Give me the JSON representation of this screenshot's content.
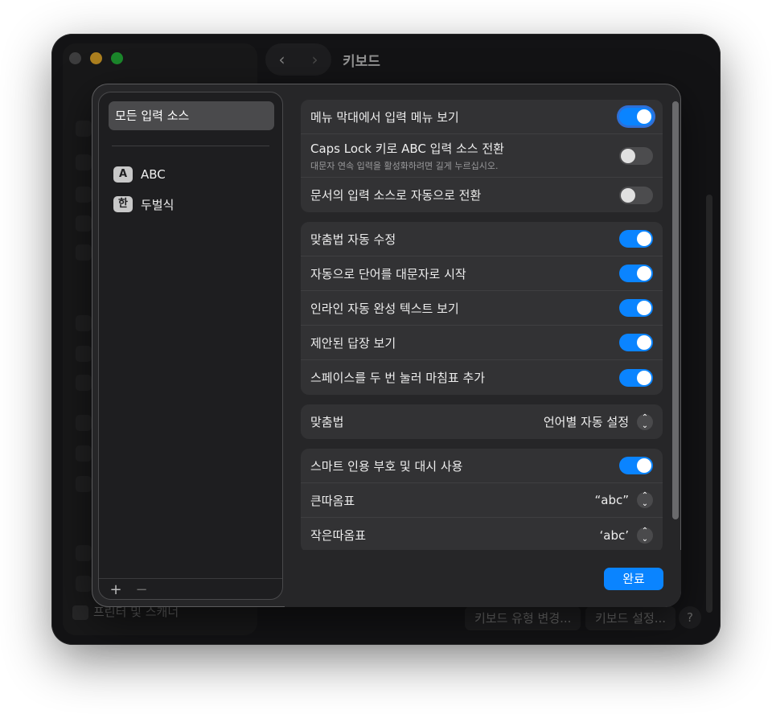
{
  "back_window": {
    "title": "키보드",
    "footer_sidebar_item": "프린터 및 스캐너",
    "footer_buttons": [
      "키보드 유형 변경...",
      "키보드 설정..."
    ],
    "help_label": "?"
  },
  "sheet": {
    "sidebar": {
      "selected_label": "모든 입력 소스",
      "sources": [
        {
          "badge": "A",
          "label": "ABC"
        },
        {
          "badge": "한",
          "label": "두벌식"
        }
      ],
      "add_label": "+",
      "remove_label": "−"
    },
    "group1": [
      {
        "label": "메뉴 막대에서 입력 메뉴 보기",
        "toggle": true
      },
      {
        "label": "Caps Lock 키로 ABC 입력 소스 전환",
        "sub": "대문자 연속 입력을 활성화하려면 길게 누르십시오.",
        "toggle": false
      },
      {
        "label": "문서의 입력 소스로 자동으로 전환",
        "toggle": false
      }
    ],
    "group2": [
      {
        "label": "맞춤법 자동 수정",
        "toggle": true
      },
      {
        "label": "자동으로 단어를 대문자로 시작",
        "toggle": true
      },
      {
        "label": "인라인 자동 완성 텍스트 보기",
        "toggle": true
      },
      {
        "label": "제안된 답장 보기",
        "toggle": true
      },
      {
        "label": "스페이스를 두 번 눌러 마침표 추가",
        "toggle": true
      }
    ],
    "spelling": {
      "label": "맞춤법",
      "value": "언어별 자동 설정"
    },
    "group4": {
      "smart_quotes": {
        "label": "스마트 인용 부호 및 대시 사용",
        "toggle": true
      },
      "double_quotes": {
        "label": "큰따옴표",
        "value": "“abc”"
      },
      "single_quotes": {
        "label": "작은따옴표",
        "value": "‘abc’"
      }
    },
    "done_label": "완료"
  },
  "colors": {
    "accent": "#0a84ff",
    "sheet_bg": "#262628",
    "group_bg": "#323234"
  }
}
